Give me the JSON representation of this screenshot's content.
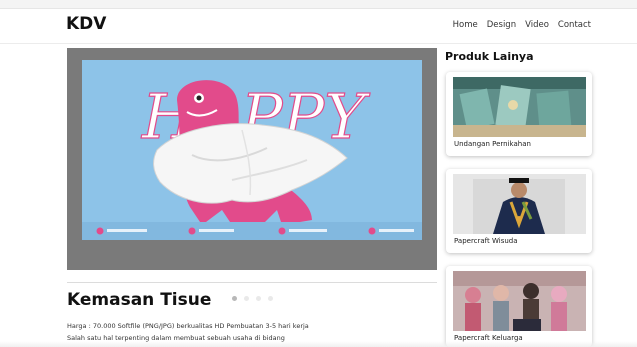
{
  "brand": "KDV",
  "nav": [
    "Home",
    "Design",
    "Video",
    "Contact"
  ],
  "carousel": {
    "slide_text": "HAPPY",
    "indicator_count": 4,
    "active_index": 0
  },
  "product": {
    "title": "Kemasan Tisue",
    "desc_line1": "Harga : 70.000 Softfile (PNG/JPG) berkualitas HD Pembuatan 3-5 hari kerja",
    "desc_line2": "Salah satu hal terpenting dalam membuat sebuah usaha di bidang"
  },
  "sidebar": {
    "title": "Produk Lainya",
    "items": [
      {
        "label": "Undangan Pernikahan",
        "icon": "invitation-photo"
      },
      {
        "label": "Papercraft Wisuda",
        "icon": "graduation-photo"
      },
      {
        "label": "Papercraft Keluarga",
        "icon": "family-photo"
      }
    ]
  },
  "colors": {
    "accent_pink": "#e24b8b",
    "slide_bg": "#8dc3e8",
    "carousel_bg": "#7a7a7a"
  }
}
